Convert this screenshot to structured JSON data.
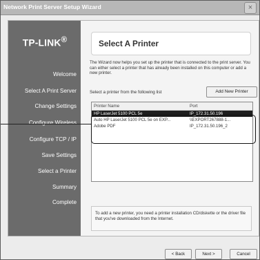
{
  "window": {
    "title": "Network Print Server Setup Wizard",
    "close_symbol": "×"
  },
  "sidebar": {
    "logo": "TP-LINK",
    "logo_mark": "®",
    "items": [
      {
        "label": "Welcome"
      },
      {
        "label": "Select A Print Server"
      },
      {
        "label": "Change Settings"
      },
      {
        "label": "Configure Wireless"
      },
      {
        "label": "Configure TCP / IP"
      },
      {
        "label": "Save Settings"
      },
      {
        "label": "Select a Printer"
      },
      {
        "label": "Summary"
      },
      {
        "label": "Complete"
      }
    ]
  },
  "main": {
    "heading": "Select A Printer",
    "description": "The Wizard now helps you set up the printer that is connected to the print server. You can either select a printer that has already been installed on this computer or add a new printer.",
    "select_label": "Select a printer from the following list",
    "add_button": "Add New Printer",
    "columns": {
      "name": "Printer Name",
      "port": "Port"
    },
    "rows": [
      {
        "name": "HP LaserJet 5100 PCL 5e",
        "port": "IP_172.31.50.196",
        "selected": true
      },
      {
        "name": "Auto HP LaserJet 5100 PCL 5e on EXP...",
        "port": "\\\\EXPORT267888-1...",
        "selected": false
      },
      {
        "name": "Adobe PDF",
        "port": "IP_172.31.50.196_2",
        "selected": false
      }
    ],
    "hint": "To add a new printer, you need a printer installation CD/diskette or the driver file that you've downloaded from the Internet."
  },
  "footer": {
    "back": "< Back",
    "next": "Next >",
    "cancel": "Cancel"
  }
}
